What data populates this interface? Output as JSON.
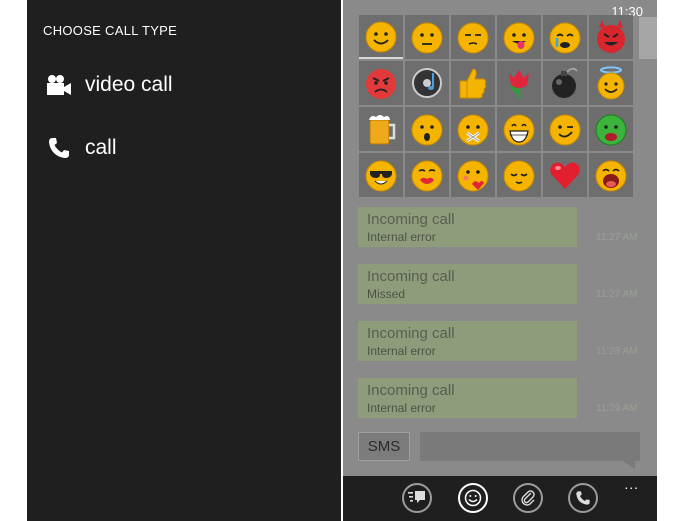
{
  "call_menu": {
    "title": "CHOOSE CALL TYPE",
    "options": [
      {
        "label": "video call",
        "icon": "video-camera-icon"
      },
      {
        "label": "call",
        "icon": "phone-icon"
      }
    ]
  },
  "status_bar": {
    "time": "11:30"
  },
  "emoji_picker": {
    "emojis": [
      "smile",
      "neutral",
      "sleepy",
      "tongue",
      "crying",
      "devil",
      "angry",
      "music-disc",
      "thumbs-up",
      "tulip",
      "bomb",
      "angel",
      "beer",
      "surprised",
      "mute",
      "grin",
      "wink",
      "sick",
      "cool",
      "kiss",
      "blush-kiss",
      "content",
      "heart",
      "laugh"
    ]
  },
  "messages": [
    {
      "title": "Incoming call",
      "detail": "Internal error",
      "time": "11:27 AM"
    },
    {
      "title": "Incoming call",
      "detail": "Missed",
      "time": "11:27 AM"
    },
    {
      "title": "Incoming call",
      "detail": "Internal error",
      "time": "11:28 AM"
    },
    {
      "title": "Incoming call",
      "detail": "Internal error",
      "time": "11:29 AM"
    }
  ],
  "composer": {
    "sms_label": "SMS"
  },
  "app_bar": {
    "buttons": [
      "message-list-icon",
      "emoji-icon",
      "attach-icon",
      "phone-icon"
    ],
    "more": "..."
  },
  "colors": {
    "panel_dark": "#1f1f1f",
    "overlay_gray": "#8a8a8a",
    "bubble_green": "#8f9c7c",
    "emoji_yellow": "#f5b400"
  }
}
